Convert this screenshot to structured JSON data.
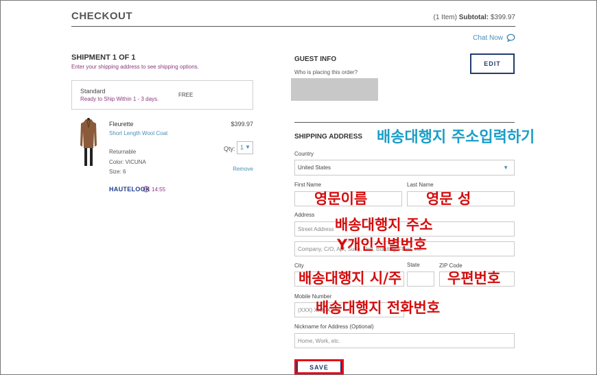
{
  "header": {
    "title": "CHECKOUT",
    "item_count": "(1 Item)",
    "subtotal_label": "Subtotal:",
    "subtotal_value": "$399.97",
    "chat": "Chat Now"
  },
  "shipment": {
    "title": "SHIPMENT 1 OF 1",
    "subtitle": "Enter your shipping address to see shipping options.",
    "method": {
      "name": "Standard",
      "eta": "Ready to Ship Within 1 - 3 days.",
      "price": "FREE"
    }
  },
  "item": {
    "name": "Fleurette",
    "desc": "Short Length Wool Coat",
    "price": "$399.97",
    "returnable": "Returnable",
    "color": "Color: VICUNA",
    "size": "Size: 6",
    "qty_label": "Qty:",
    "qty_value": "1",
    "remove": "Remove",
    "brand": "HAUTELOOK",
    "timer": "14:55"
  },
  "guest": {
    "title": "GUEST INFO",
    "subtitle": "Who is placing this order?",
    "edit": "EDIT"
  },
  "shipping": {
    "title": "SHIPPING ADDRESS",
    "country_label": "Country",
    "country_value": "United States",
    "first_name_label": "First Name",
    "last_name_label": "Last Name",
    "address_label": "Address",
    "street_placeholder": "Street Address",
    "company_placeholder": "Company, C/O, Apt, Suite, Unit, Building, Floor, etc.",
    "city_label": "City",
    "state_label": "State",
    "zip_label": "ZIP Code",
    "mobile_label": "Mobile Number",
    "mobile_placeholder": "(XXX) XXX-XXXX",
    "nickname_label": "Nickname for Address (Optional)",
    "nickname_placeholder": "Home, Work, etc.",
    "save": "SAVE"
  },
  "annotations": {
    "shipping_header": "배송대행지 주소입력하기",
    "first_name": "영문이름",
    "last_name": "영문 성",
    "address": "배송대행지 주소",
    "personal_id": "Y개인식별번호",
    "city_state": "배송대행지 시/주",
    "zip": "우편번호",
    "phone": "배송대행지 전화번호"
  },
  "colors": {
    "accent_blue": "#4a8db5",
    "brand_navy": "#1d3a6b",
    "purple_text": "#8a3a7c",
    "annotation_red": "#d40c0c",
    "annotation_blue": "#1a9ec7"
  }
}
